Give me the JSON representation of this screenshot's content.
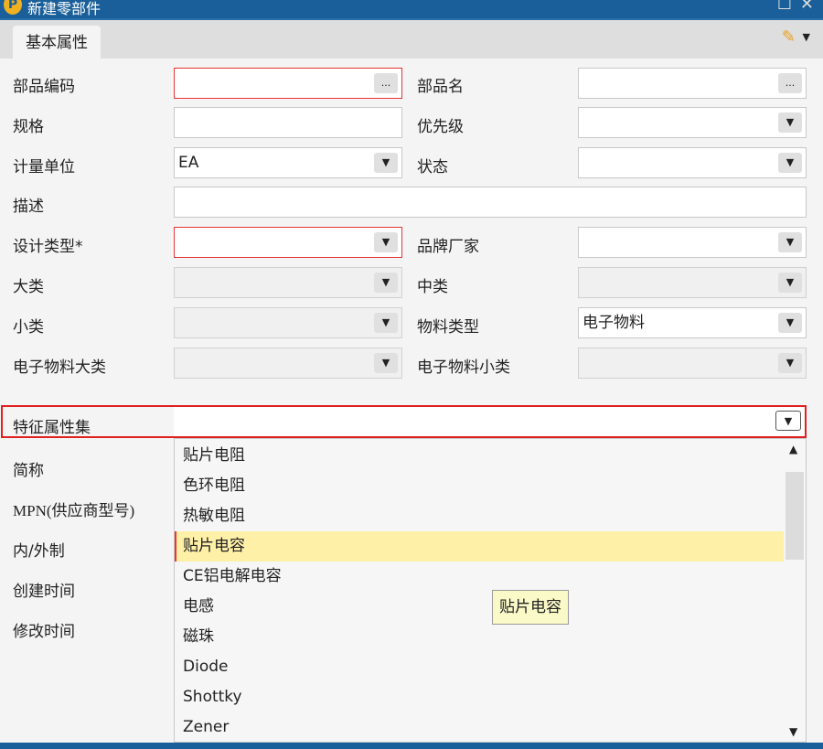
{
  "window": {
    "title": "新建零部件",
    "logo": "P"
  },
  "tabs": [
    {
      "label": "基本属性"
    }
  ],
  "fields": {
    "part_code": {
      "label": "部品编码",
      "value": "",
      "button": "..."
    },
    "part_name": {
      "label": "部品名",
      "value": "",
      "button": "..."
    },
    "spec": {
      "label": "规格",
      "value": ""
    },
    "priority": {
      "label": "优先级",
      "value": ""
    },
    "unit": {
      "label": "计量单位",
      "value": "EA"
    },
    "status": {
      "label": "状态",
      "value": ""
    },
    "description": {
      "label": "描述",
      "value": ""
    },
    "design_type": {
      "label": "设计类型*",
      "value": ""
    },
    "brand": {
      "label": "品牌厂家",
      "value": ""
    },
    "category_major": {
      "label": "大类",
      "value": ""
    },
    "category_mid": {
      "label": "中类",
      "value": ""
    },
    "category_minor": {
      "label": "小类",
      "value": ""
    },
    "material_type": {
      "label": "物料类型",
      "value": "电子物料"
    },
    "elec_major": {
      "label": "电子物料大类",
      "value": ""
    },
    "elec_minor": {
      "label": "电子物料小类",
      "value": ""
    },
    "feature_set": {
      "label": "特征属性集",
      "value": ""
    },
    "short_name": {
      "label": "简称"
    },
    "mpn": {
      "label": "MPN(供应商型号)"
    },
    "make_type": {
      "label": "内/外制"
    },
    "created": {
      "label": "创建时间"
    },
    "modified": {
      "label": "修改时间"
    }
  },
  "dropdown": {
    "items": [
      "贴片电阻",
      "色环电阻",
      "热敏电阻",
      "贴片电容",
      "CE铝电解电容",
      "电感",
      "磁珠",
      "Diode",
      "Shottky",
      "Zener"
    ],
    "selected": "贴片电容",
    "tooltip": "贴片电容"
  }
}
